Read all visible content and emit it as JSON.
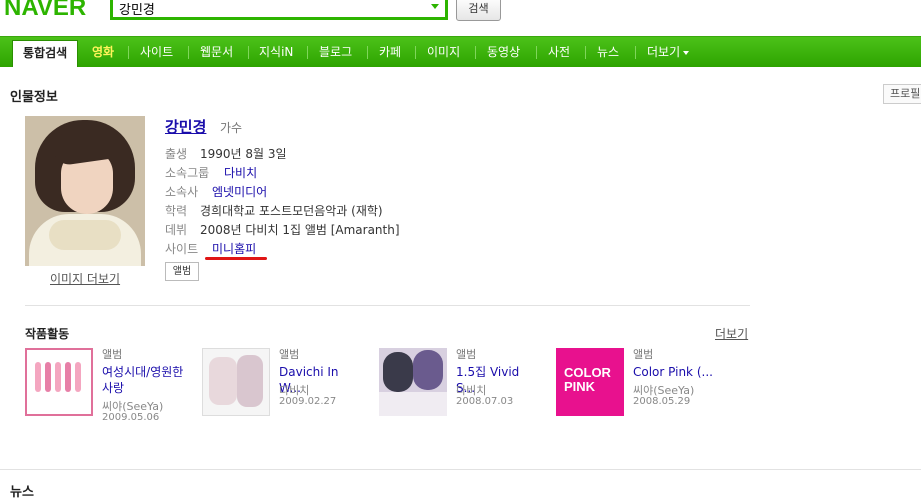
{
  "header": {
    "logo": "NAVER",
    "search_value": "강민경",
    "search_button": "검색"
  },
  "tabs": [
    {
      "label": "통합검색",
      "active": true
    },
    {
      "label": "영화",
      "highlight": true
    },
    {
      "label": "사이트"
    },
    {
      "label": "웹문서"
    },
    {
      "label": "지식iN"
    },
    {
      "label": "블로그"
    },
    {
      "label": "카페"
    },
    {
      "label": "이미지"
    },
    {
      "label": "동영상"
    },
    {
      "label": "사전"
    },
    {
      "label": "뉴스"
    },
    {
      "label": "더보기"
    }
  ],
  "person": {
    "section_title": "인물정보",
    "profile_button": "프로필",
    "name": "강민경",
    "job": "가수",
    "more_images": "이미지 더보기",
    "info": [
      {
        "label": "출생",
        "value": "1990년 8월 3일"
      },
      {
        "label": "소속그룹",
        "value": "다비치"
      },
      {
        "label": "소속사",
        "value": "엠넷미디어"
      },
      {
        "label": "학력",
        "value": "경희대학교 포스트모던음악과 (재학)"
      },
      {
        "label": "데뷔",
        "value": "2008년 다비치 1집 앨범 [Amaranth]"
      },
      {
        "label": "사이트",
        "value": "미니홈피"
      }
    ],
    "album_button": "앨범"
  },
  "works": {
    "section_title": "작품활동",
    "more": "더보기",
    "items": [
      {
        "type": "앨범",
        "title": "여성시대/영원한 사랑",
        "artist": "씨야(SeeYa)",
        "date": "2009.05.06"
      },
      {
        "type": "앨범",
        "title": "Davichi In W...",
        "artist": "다비치",
        "date": "2009.02.27"
      },
      {
        "type": "앨범",
        "title": "1.5집 Vivid S...",
        "artist": "다비치",
        "date": "2008.07.03"
      },
      {
        "type": "앨범",
        "title": "Color Pink (...",
        "artist": "씨야(SeeYa)",
        "date": "2008.05.29"
      }
    ],
    "cover4_text": "COLOR PINK"
  },
  "news": {
    "section_title": "뉴스"
  },
  "colors": {
    "brand_green": "#2db400",
    "link_blue": "#1a0dab",
    "highlight_red": "#e01515"
  }
}
